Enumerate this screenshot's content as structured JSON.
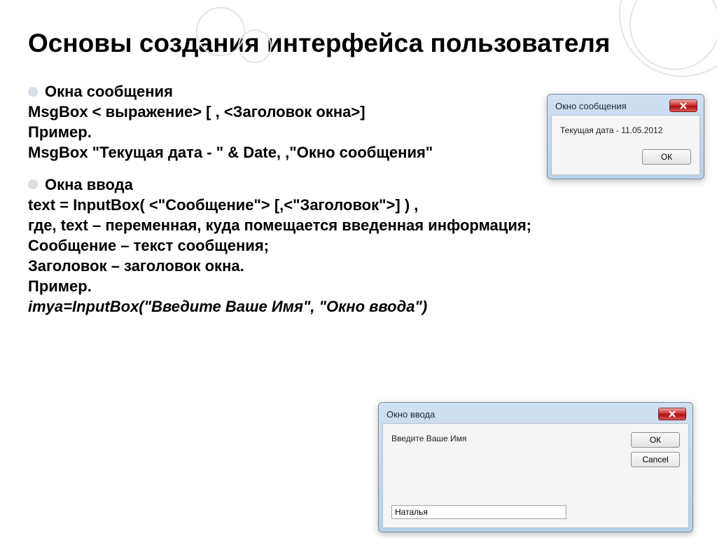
{
  "title": "Основы создания интерфейса пользователя",
  "section1": {
    "bullet": "Окна сообщения",
    "line1": "MsgBox < выражение> [ , <Заголовок окна>]",
    "line2": "Пример.",
    "line3": "MsgBox \"Текущая дата - \" & Date, ,\"Окно сообщения\""
  },
  "section2": {
    "bullet": "Окна ввода",
    "line1": "text = InputBox( <\"Сообщение\"> [,<\"Заголовок\">] ) ,",
    "line2": "где, text – переменная, куда помещается введенная информация;",
    "line3": "Сообщение – текст сообщения;",
    "line4": "Заголовок – заголовок окна.",
    "line5": "Пример.",
    "line6": "imya=InputBox(\"Введите Ваше Имя\", \"Окно ввода\")"
  },
  "msgbox": {
    "title": "Окно сообщения",
    "text": "Текущая дата - 11.05.2012",
    "ok": "ОК"
  },
  "inputbox": {
    "title": "Окно ввода",
    "prompt": "Введите Ваше Имя",
    "ok": "ОК",
    "cancel": "Cancel",
    "value": "Наталья"
  }
}
